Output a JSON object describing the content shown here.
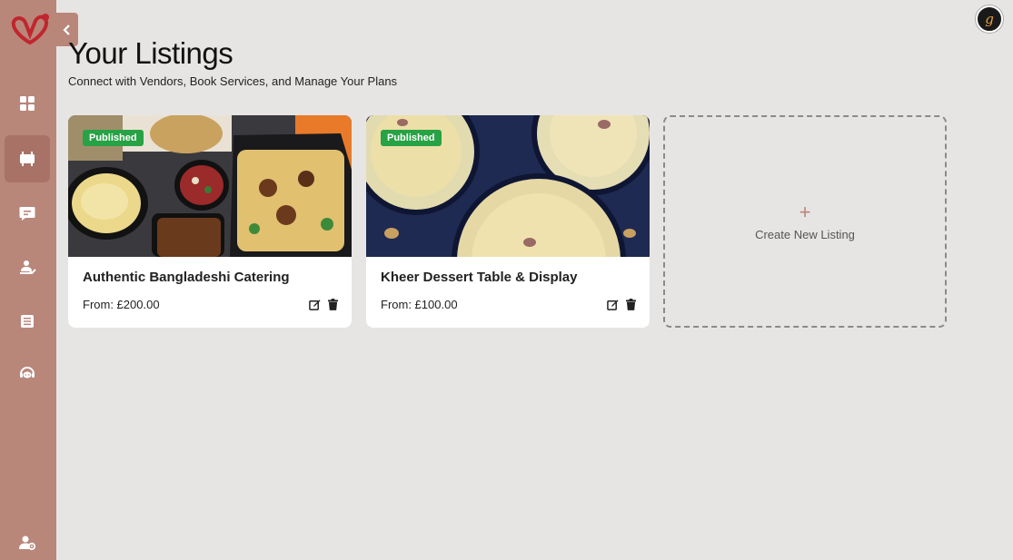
{
  "header": {
    "title": "Your Listings",
    "subtitle": "Connect with Vendors, Book Services, and Manage Your Plans",
    "avatar_letter": "g"
  },
  "sidebar": {
    "brand_color": "#b9867a",
    "active_color": "#a87366",
    "items": [
      {
        "icon": "dashboard-grid-icon",
        "active": false
      },
      {
        "icon": "listings-icon",
        "active": true
      },
      {
        "icon": "messages-icon",
        "active": false
      },
      {
        "icon": "bookings-icon",
        "active": false
      },
      {
        "icon": "plans-icon",
        "active": false
      },
      {
        "icon": "support-icon",
        "active": false
      }
    ],
    "footer_icon": "user-settings-icon"
  },
  "listings": [
    {
      "status": "Published",
      "title": "Authentic Bangladeshi Catering",
      "price": "From: £200.00"
    },
    {
      "status": "Published",
      "title": "Kheer Dessert Table & Display",
      "price": "From: £100.00"
    }
  ],
  "create": {
    "plus": "+",
    "label": "Create New Listing"
  },
  "colors": {
    "background": "#e7e5e3",
    "published_badge": "#27a244"
  }
}
